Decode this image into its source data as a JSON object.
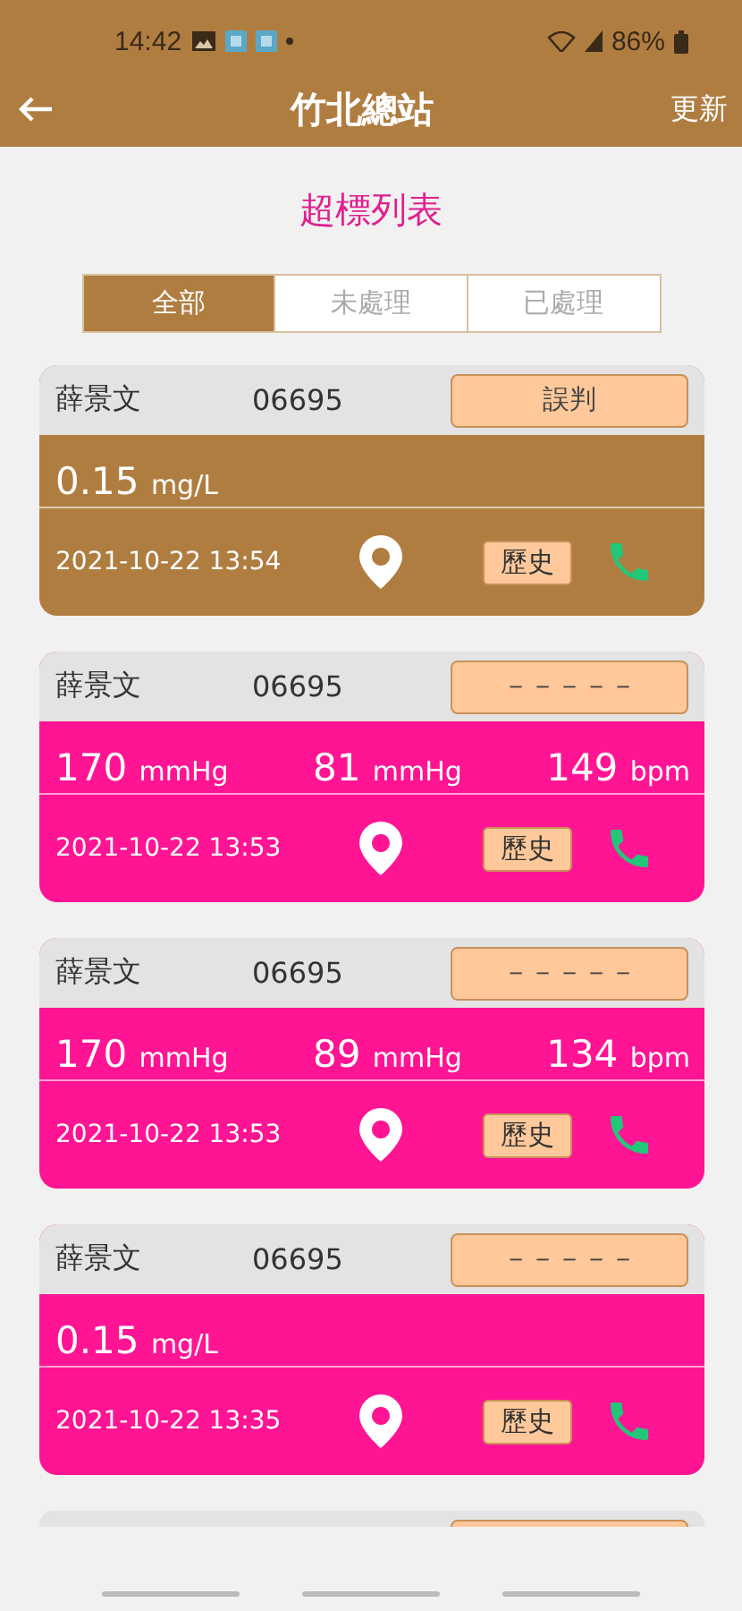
{
  "status_bar": {
    "time": "14:42",
    "battery": "86%"
  },
  "header": {
    "title": "竹北總站",
    "action": "更新"
  },
  "page_title": "超標列表",
  "tabs": [
    {
      "label": "全部",
      "selected": true
    },
    {
      "label": "未處理",
      "selected": false
    },
    {
      "label": "已處理",
      "selected": false
    }
  ],
  "records": [
    {
      "name": "薛景文",
      "id": "06695",
      "status": "誤判",
      "kind": "single",
      "color": "#b07d41",
      "readings": [
        {
          "value": "0.15",
          "unit": "mg/L"
        }
      ],
      "time": "2021-10-22 13:54",
      "history": "歷史"
    },
    {
      "name": "薛景文",
      "id": "06695",
      "status": "－－－－－",
      "kind": "triple",
      "color": "#ff1493",
      "readings": [
        {
          "value": "170",
          "unit": "mmHg"
        },
        {
          "value": "81",
          "unit": "mmHg"
        },
        {
          "value": "149",
          "unit": "bpm"
        }
      ],
      "time": "2021-10-22 13:53",
      "history": "歷史"
    },
    {
      "name": "薛景文",
      "id": "06695",
      "status": "－－－－－",
      "kind": "triple",
      "color": "#ff1493",
      "readings": [
        {
          "value": "170",
          "unit": "mmHg"
        },
        {
          "value": "89",
          "unit": "mmHg"
        },
        {
          "value": "134",
          "unit": "bpm"
        }
      ],
      "time": "2021-10-22 13:53",
      "history": "歷史"
    },
    {
      "name": "薛景文",
      "id": "06695",
      "status": "－－－－－",
      "kind": "single",
      "color": "#ff1493",
      "readings": [
        {
          "value": "0.15",
          "unit": "mg/L"
        }
      ],
      "time": "2021-10-22 13:35",
      "history": "歷史"
    },
    {
      "kind": "partial"
    }
  ]
}
